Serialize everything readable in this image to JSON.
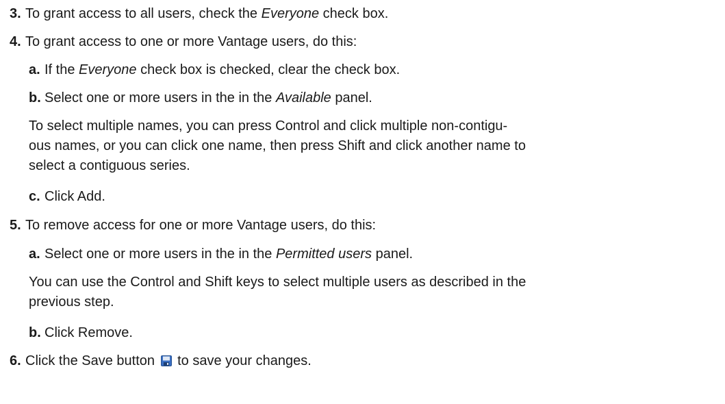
{
  "steps": [
    {
      "number": "3.",
      "text_before": "To grant access to all users, check the ",
      "em": "Everyone",
      "text_after": " check box."
    },
    {
      "number": "4.",
      "text": "To grant access to one or more Vantage users, do this:",
      "substeps": [
        {
          "letter": "a.",
          "text_before": "If the ",
          "em": "Everyone",
          "text_after": " check box is checked, clear the check box."
        },
        {
          "letter": "b.",
          "text_before": "Select one or more users in the in the ",
          "em": "Available",
          "text_after": " panel.",
          "note_lines": [
            "To select multiple names, you can press Control and click multiple non-contigu-",
            "ous names, or you can click one name, then press Shift and click another name to",
            "select a contiguous series."
          ]
        },
        {
          "letter": "c.",
          "text": "Click Add."
        }
      ]
    },
    {
      "number": "5.",
      "text": "To remove access for one or more Vantage users, do this:",
      "substeps": [
        {
          "letter": "a.",
          "text_before": "Select one or more users in the in the ",
          "em": "Permitted users",
          "text_after": " panel.",
          "note_lines": [
            "You can use the Control and Shift keys to select multiple users as described in the",
            "previous step."
          ]
        },
        {
          "letter": "b.",
          "text": "Click Remove."
        }
      ]
    },
    {
      "number": "6.",
      "text_before": "Click the Save button ",
      "icon": "save-disk-icon",
      "text_after": " to save your changes."
    }
  ],
  "colors": {
    "text": "#1a1a1a",
    "save_icon_body": "#3a6fc4",
    "save_icon_label": "#dfe8f5"
  }
}
